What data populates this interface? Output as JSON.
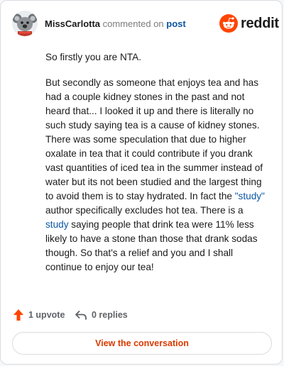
{
  "header": {
    "username": "MissCarlotta",
    "action_text": "commented on",
    "post_link": "post",
    "brand": "reddit"
  },
  "comment": {
    "para1": "So firstly you are NTA.",
    "para2_part1": "But secondly as someone that enjoys tea and has had a couple kidney stones in the past and not heard that... I looked it up and there is literally no such study saying tea is a cause of kidney stones. There was some speculation that due to higher oxalate in tea that it could contribute if you drank vast quantities of iced tea in the summer instead of water but its not been studied and the largest thing to avoid them is to stay hydrated. In fact the ",
    "link1": "\"study\"",
    "para2_part2": " author specifically excludes hot tea. There is a ",
    "link2": "study",
    "para2_part3": " saying people that drink tea were 11% less likely to have a stone than those that drank sodas though. So that's a relief and you and I shall continue to enjoy our tea!"
  },
  "actions": {
    "upvote_label": "1 upvote",
    "replies_label": "0 replies"
  },
  "cta_label": "View the conversation",
  "icons": {
    "upvote": "upvote-arrow-icon",
    "reply": "reply-arrow-icon",
    "brand": "reddit-alien-icon",
    "avatar": "koala-avatar"
  },
  "colors": {
    "brand_orange": "#ff4500",
    "link_blue": "#0b57a3",
    "cta_text": "#d93a00"
  }
}
